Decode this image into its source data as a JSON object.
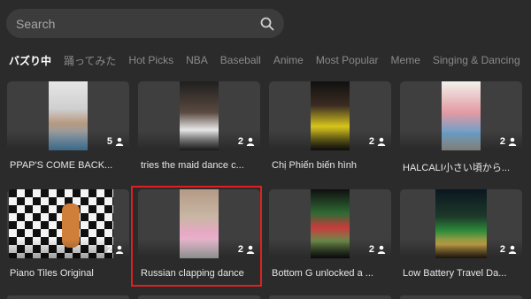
{
  "search": {
    "placeholder": "Search",
    "icon": "search-icon"
  },
  "tabs": [
    {
      "label": "バズり中",
      "active": true
    },
    {
      "label": "踊ってみた",
      "active": false
    },
    {
      "label": "Hot Picks",
      "active": false
    },
    {
      "label": "NBA",
      "active": false
    },
    {
      "label": "Baseball",
      "active": false
    },
    {
      "label": "Anime",
      "active": false
    },
    {
      "label": "Most Popular",
      "active": false
    },
    {
      "label": "Meme",
      "active": false
    },
    {
      "label": "Singing & Dancing",
      "active": false
    }
  ],
  "cards": [
    {
      "title": "PPAP'S COME BACK...",
      "players": "5",
      "colors": [
        "#d9d9d9",
        "#c8a48a",
        "#5b9fcf"
      ],
      "player_icon": "person-icon"
    },
    {
      "title": "tries the maid dance c...",
      "players": "2",
      "colors": [
        "#222222",
        "#e6e6e6",
        "#7a5a48"
      ],
      "player_icon": "person-icon"
    },
    {
      "title": "Chị Phiến biến hình",
      "players": "2",
      "colors": [
        "#1a1a1a",
        "#d6c41d",
        "#3b2c22"
      ],
      "player_icon": "person-icon"
    },
    {
      "title": "HALCALI小さい頃から...",
      "players": "2",
      "colors": [
        "#f1f1ea",
        "#6ba0c8",
        "#e49aa4"
      ],
      "player_icon": "person-icon"
    },
    {
      "title": "Piano Tiles Original",
      "players": "2",
      "colors": [
        "#f4f4f4",
        "#111111",
        "#d07f3a"
      ],
      "player_icon": "person-icon"
    },
    {
      "title": "Russian clapping dance",
      "players": "2",
      "colors": [
        "#b49a86",
        "#e9a8c6",
        "#d8d8d8"
      ],
      "player_icon": "person-icon"
    },
    {
      "title": "Bottom G unlocked a ...",
      "players": "2",
      "colors": [
        "#0f0f0f",
        "#2f6b34",
        "#c83b3b"
      ],
      "player_icon": "person-icon"
    },
    {
      "title": "Low Battery Travel Da...",
      "players": "2",
      "colors": [
        "#0b1620",
        "#2d8a3a",
        "#c9a64a"
      ],
      "player_icon": "person-icon"
    }
  ]
}
